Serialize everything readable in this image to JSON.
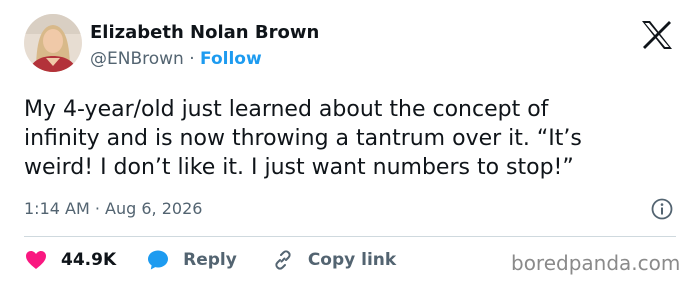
{
  "author": {
    "name": "Elizabeth Nolan Brown",
    "handle": "@ENBrown",
    "separator": "·",
    "follow_label": "Follow"
  },
  "tweet": {
    "line1": "My 4-year/old just learned about the concept of",
    "line2": "infinity and is now throwing a tantrum over it. “It’s",
    "line3": "weird! I don’t like it. I just want numbers to stop!”",
    "timestamp": "1:14 AM · Aug 6, 2026"
  },
  "actions": {
    "like_count": "44.9K",
    "reply_label": "Reply",
    "copy_label": "Copy link"
  },
  "watermark": "boredpanda.com",
  "colors": {
    "accent": "#1d9bf0",
    "like": "#f91880",
    "text": "#0f1419",
    "muted": "#536471"
  },
  "icons": {
    "logo": "x-logo-icon",
    "info": "info-icon",
    "like": "heart-icon",
    "reply": "speech-bubble-icon",
    "copy": "link-icon"
  }
}
